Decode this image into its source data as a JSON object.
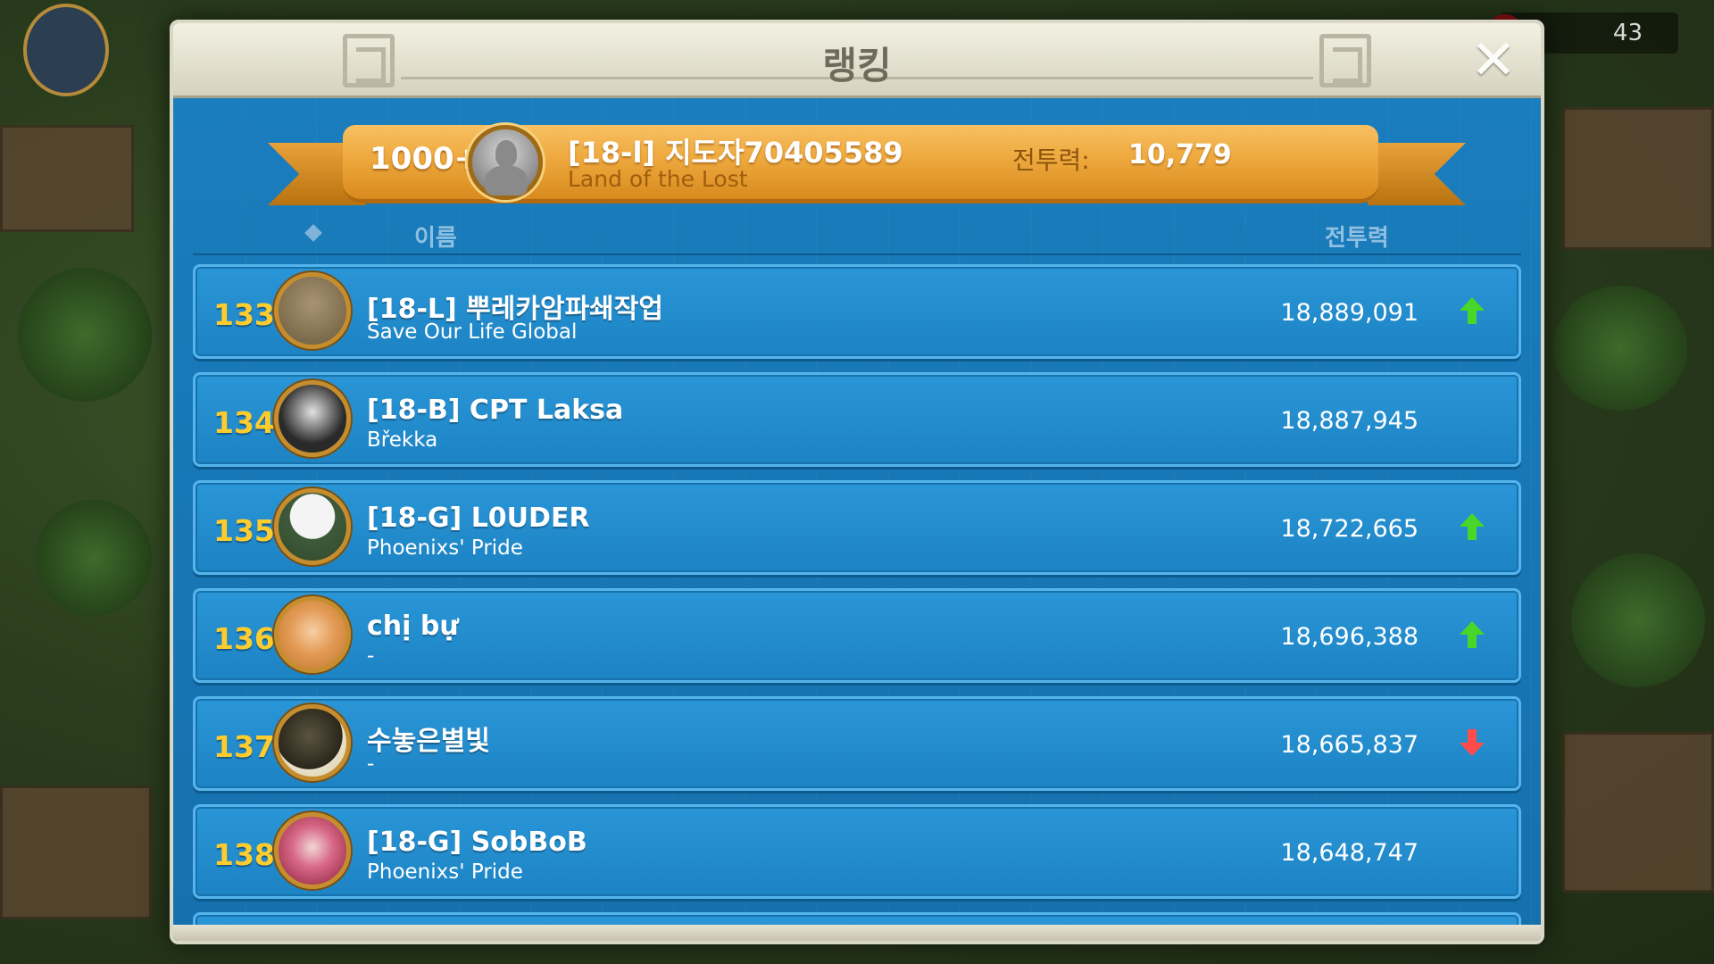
{
  "modal": {
    "title": "랭킹",
    "close_icon": "close-icon"
  },
  "hud": {
    "counter": "43"
  },
  "player": {
    "rank": "1000+",
    "name": "[18-l] 지도자70405589",
    "alliance": "Land of the Lost",
    "power_label": "전투력:",
    "power_value": "10,779"
  },
  "columns": {
    "name": "이름",
    "power": "전투력"
  },
  "rows": [
    {
      "rank": "133",
      "name": "[18-L] 뿌레카암파쇄작업",
      "alliance": "Save Our Life Global",
      "power": "18,889,091",
      "trend": "up",
      "avatar_color": "#7a6a50"
    },
    {
      "rank": "134",
      "name": "[18-B] CPT Laksa",
      "alliance": "Břekka",
      "power": "18,887,945",
      "trend": "none",
      "avatar_color": "#3c3c3c"
    },
    {
      "rank": "135",
      "name": "[18-G] L0UDER",
      "alliance": "Phoenixs' Pride",
      "power": "18,722,665",
      "trend": "up",
      "avatar_color": "#e8e8e8"
    },
    {
      "rank": "136",
      "name": "chị bự",
      "alliance": "-",
      "power": "18,696,388",
      "trend": "up",
      "avatar_color": "#e8a66a"
    },
    {
      "rank": "137",
      "name": "수놓은별빛",
      "alliance": "-",
      "power": "18,665,837",
      "trend": "down",
      "avatar_color": "#3b3525"
    },
    {
      "rank": "138",
      "name": "[18-G] SobBoB",
      "alliance": "Phoenixs' Pride",
      "power": "18,648,747",
      "trend": "none",
      "avatar_color": "#c0345a"
    }
  ],
  "colors": {
    "modal_blue": "#1678b7",
    "rank_gold": "#ffcc2e",
    "trend_up": "#49d628",
    "trend_down": "#ff4b4b",
    "banner_gold": "#eea93e"
  }
}
